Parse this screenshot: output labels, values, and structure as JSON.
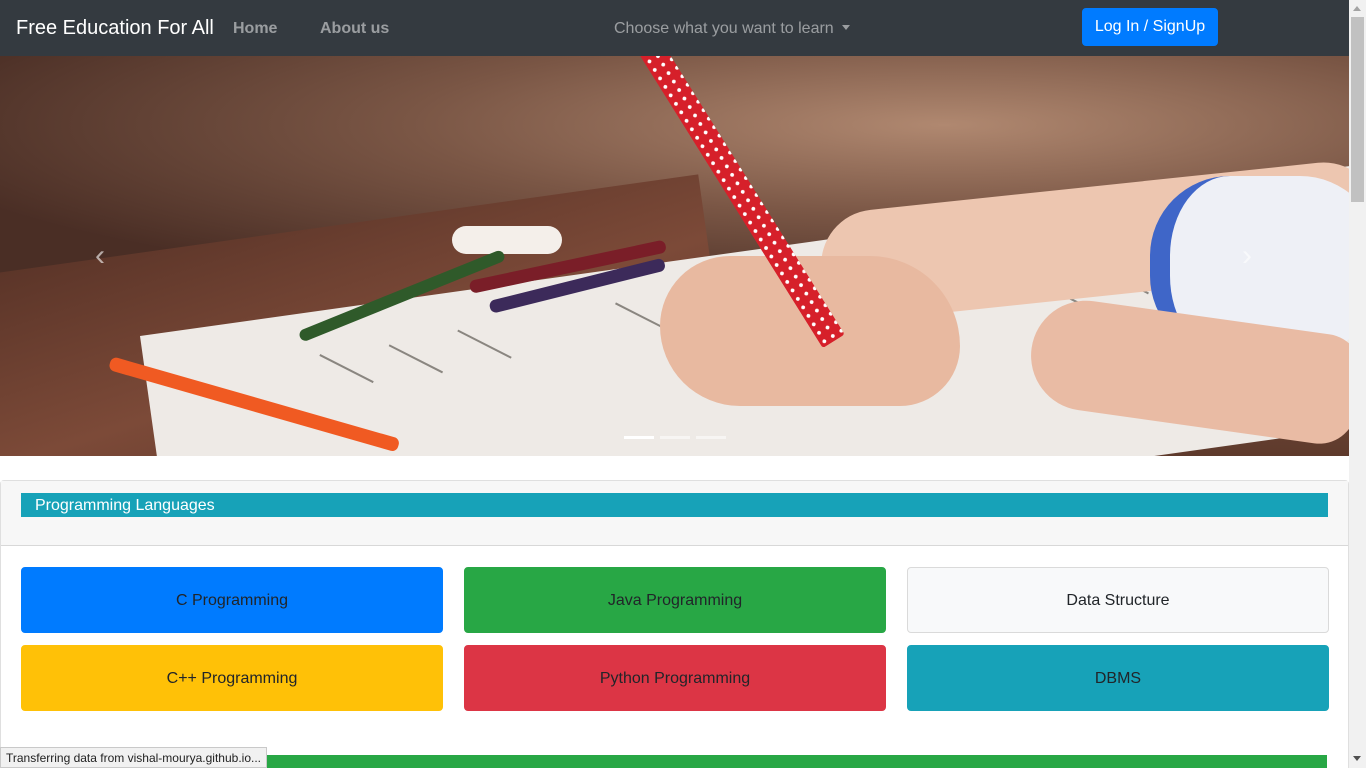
{
  "navbar": {
    "brand": "Free Education For All",
    "links": [
      "Home",
      "About us"
    ],
    "dropdown_label": "Choose what you want to learn",
    "login_label": "Log In / SignUp"
  },
  "carousel": {
    "prev_icon": "‹",
    "next_icon": "›",
    "slide_count": 3,
    "active_slide": 1
  },
  "section": {
    "title": "Programming Languages",
    "courses": [
      {
        "label": "C Programming",
        "color": "#007bff"
      },
      {
        "label": "Java Programming",
        "color": "#28a745"
      },
      {
        "label": "Data Structure",
        "color": "#f8f9fa"
      },
      {
        "label": "C++ Programming",
        "color": "#ffc107"
      },
      {
        "label": "Python Programming",
        "color": "#dc3545"
      },
      {
        "label": "DBMS",
        "color": "#17a2b8"
      }
    ]
  },
  "status_bar": "Transferring data from vishal-mourya.github.io...",
  "colors": {
    "navbar": "#343a40",
    "primary": "#007bff",
    "info": "#17a2b8",
    "success": "#28a745"
  }
}
